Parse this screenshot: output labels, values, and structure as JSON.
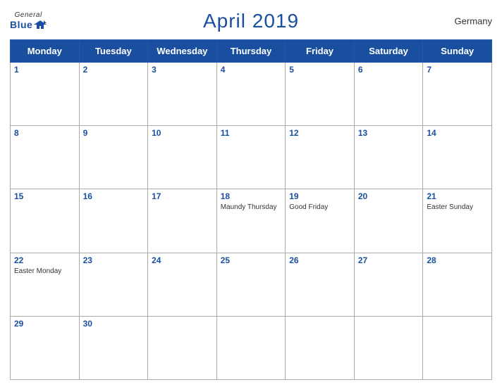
{
  "logo": {
    "general": "General",
    "blue": "Blue"
  },
  "title": "April 2019",
  "country": "Germany",
  "weekdays": [
    "Monday",
    "Tuesday",
    "Wednesday",
    "Thursday",
    "Friday",
    "Saturday",
    "Sunday"
  ],
  "weeks": [
    [
      {
        "day": 1,
        "holiday": ""
      },
      {
        "day": 2,
        "holiday": ""
      },
      {
        "day": 3,
        "holiday": ""
      },
      {
        "day": 4,
        "holiday": ""
      },
      {
        "day": 5,
        "holiday": ""
      },
      {
        "day": 6,
        "holiday": ""
      },
      {
        "day": 7,
        "holiday": ""
      }
    ],
    [
      {
        "day": 8,
        "holiday": ""
      },
      {
        "day": 9,
        "holiday": ""
      },
      {
        "day": 10,
        "holiday": ""
      },
      {
        "day": 11,
        "holiday": ""
      },
      {
        "day": 12,
        "holiday": ""
      },
      {
        "day": 13,
        "holiday": ""
      },
      {
        "day": 14,
        "holiday": ""
      }
    ],
    [
      {
        "day": 15,
        "holiday": ""
      },
      {
        "day": 16,
        "holiday": ""
      },
      {
        "day": 17,
        "holiday": ""
      },
      {
        "day": 18,
        "holiday": "Maundy Thursday"
      },
      {
        "day": 19,
        "holiday": "Good Friday"
      },
      {
        "day": 20,
        "holiday": ""
      },
      {
        "day": 21,
        "holiday": "Easter Sunday"
      }
    ],
    [
      {
        "day": 22,
        "holiday": "Easter Monday"
      },
      {
        "day": 23,
        "holiday": ""
      },
      {
        "day": 24,
        "holiday": ""
      },
      {
        "day": 25,
        "holiday": ""
      },
      {
        "day": 26,
        "holiday": ""
      },
      {
        "day": 27,
        "holiday": ""
      },
      {
        "day": 28,
        "holiday": ""
      }
    ],
    [
      {
        "day": 29,
        "holiday": ""
      },
      {
        "day": 30,
        "holiday": ""
      },
      {
        "day": null,
        "holiday": ""
      },
      {
        "day": null,
        "holiday": ""
      },
      {
        "day": null,
        "holiday": ""
      },
      {
        "day": null,
        "holiday": ""
      },
      {
        "day": null,
        "holiday": ""
      }
    ]
  ]
}
